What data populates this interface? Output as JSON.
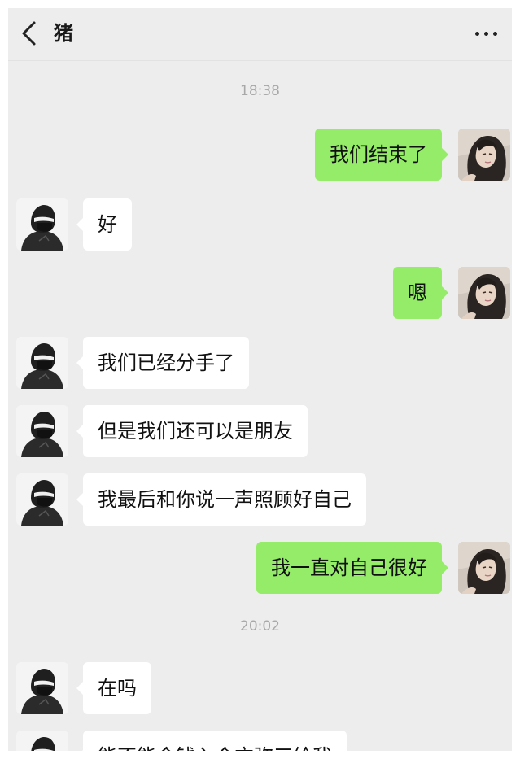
{
  "header": {
    "back_icon": "chevron-left-icon",
    "title": "猪",
    "more_icon": "more-horizontal-icon"
  },
  "colors": {
    "background": "#ededed",
    "incoming_bubble": "#ffffff",
    "outgoing_bubble": "#95ec69"
  },
  "timestamps": [
    "18:38",
    "20:02"
  ],
  "messages": [
    {
      "side": "outgoing",
      "text": "我们结束了"
    },
    {
      "side": "incoming",
      "text": "好"
    },
    {
      "side": "outgoing",
      "text": "嗯"
    },
    {
      "side": "incoming",
      "text": "我们已经分手了"
    },
    {
      "side": "incoming",
      "text": "但是我们还可以是朋友"
    },
    {
      "side": "incoming",
      "text": "我最后和你说一声照顾好自己"
    },
    {
      "side": "outgoing",
      "text": "我一直对自己很好"
    },
    {
      "side": "incoming",
      "text": "在吗"
    },
    {
      "side": "incoming",
      "text": "能不能会钱入会方弥三给我"
    }
  ]
}
